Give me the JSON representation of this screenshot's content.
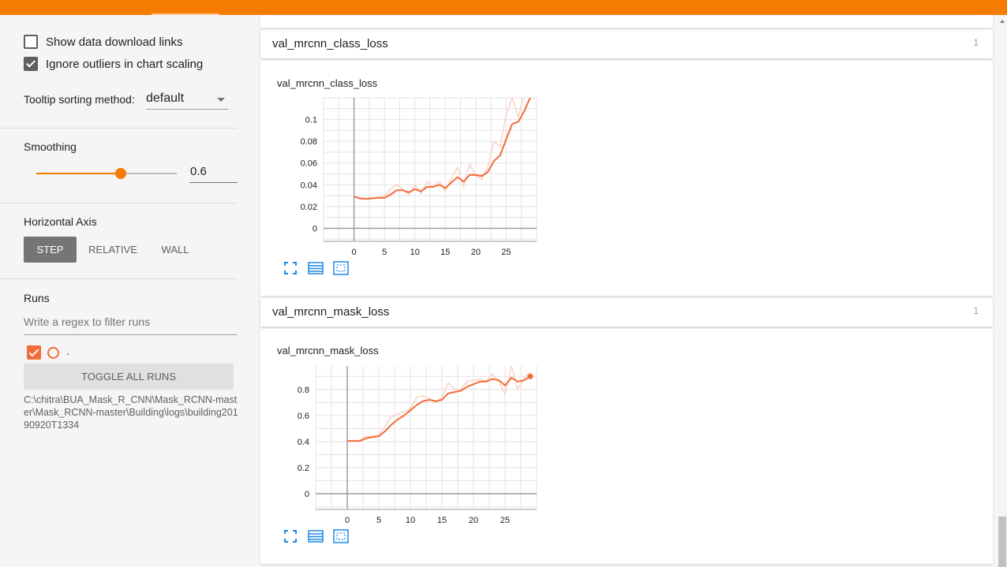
{
  "sidebar": {
    "show_download_links": {
      "label": "Show data download links",
      "checked": false
    },
    "ignore_outliers": {
      "label": "Ignore outliers in chart scaling",
      "checked": true
    },
    "tooltip_sorting": {
      "label": "Tooltip sorting method:",
      "value": "default"
    },
    "smoothing": {
      "label": "Smoothing",
      "value": "0.6",
      "fraction": 0.6
    },
    "horizontal_axis": {
      "label": "Horizontal Axis",
      "options": [
        "STEP",
        "RELATIVE",
        "WALL"
      ],
      "selected": "STEP"
    },
    "runs": {
      "label": "Runs",
      "filter_placeholder": "Write a regex to filter runs",
      "run_name": ".",
      "toggle_label": "TOGGLE ALL RUNS",
      "path": "C:\\chitra\\BUA_Mask_R_CNN\\Mask_RCNN-master\\Mask_RCNN-master\\Building\\logs\\building20190920T1334"
    }
  },
  "colors": {
    "accent": "#f57c00",
    "series": "#f26b3a",
    "series_raw": "#fbd3c4"
  },
  "cards": [
    {
      "header": "val_mrcnn_class_loss",
      "count": "1",
      "chart_title": "val_mrcnn_class_loss"
    },
    {
      "header": "val_mrcnn_mask_loss",
      "count": "1",
      "chart_title": "val_mrcnn_mask_loss"
    }
  ],
  "chart_data": [
    {
      "type": "line",
      "title": "val_mrcnn_class_loss",
      "x_ticks": [
        "0",
        "5",
        "10",
        "15",
        "20",
        "25"
      ],
      "y_ticks": [
        "0",
        "0.02",
        "0.04",
        "0.06",
        "0.08",
        "0.1"
      ],
      "xlim": [
        -5,
        30
      ],
      "ylim": [
        -0.012,
        0.12
      ],
      "grid": true,
      "series": [
        {
          "role": "smoothed",
          "x": [
            0,
            1,
            2,
            3,
            4,
            5,
            6,
            7,
            8,
            9,
            10,
            11,
            12,
            13,
            14,
            15,
            16,
            17,
            18,
            19,
            20,
            21,
            22,
            23,
            24,
            25,
            26,
            27,
            28,
            29
          ],
          "y": [
            0.029,
            0.0275,
            0.027,
            0.0275,
            0.028,
            0.028,
            0.031,
            0.035,
            0.035,
            0.033,
            0.036,
            0.034,
            0.038,
            0.038,
            0.04,
            0.037,
            0.042,
            0.047,
            0.043,
            0.049,
            0.049,
            0.048,
            0.052,
            0.062,
            0.067,
            0.082,
            0.096,
            0.098,
            0.108,
            0.121
          ]
        },
        {
          "role": "raw",
          "x": [
            0,
            1,
            2,
            3,
            4,
            5,
            6,
            7,
            8,
            9,
            10,
            11,
            12,
            13,
            14,
            15,
            16,
            17,
            18,
            19,
            20,
            21,
            22,
            23,
            24,
            25,
            26,
            27,
            28,
            29
          ],
          "y": [
            0.03,
            0.027,
            0.027,
            0.028,
            0.028,
            0.03,
            0.036,
            0.04,
            0.036,
            0.031,
            0.04,
            0.032,
            0.043,
            0.039,
            0.043,
            0.034,
            0.046,
            0.056,
            0.038,
            0.059,
            0.048,
            0.045,
            0.057,
            0.08,
            0.075,
            0.105,
            0.12,
            0.102,
            0.125,
            0.13
          ]
        }
      ]
    },
    {
      "type": "line",
      "title": "val_mrcnn_mask_loss",
      "x_ticks": [
        "0",
        "5",
        "10",
        "15",
        "20",
        "25"
      ],
      "y_ticks": [
        "0",
        "0.2",
        "0.4",
        "0.6",
        "0.8"
      ],
      "xlim": [
        -5,
        30
      ],
      "ylim": [
        -0.12,
        0.98
      ],
      "grid": true,
      "series": [
        {
          "role": "smoothed",
          "x": [
            0,
            1,
            2,
            3,
            4,
            5,
            6,
            7,
            8,
            9,
            10,
            11,
            12,
            13,
            14,
            15,
            16,
            17,
            18,
            19,
            20,
            21,
            22,
            23,
            24,
            25,
            26,
            27,
            28,
            29
          ],
          "y": [
            0.405,
            0.405,
            0.405,
            0.425,
            0.435,
            0.44,
            0.48,
            0.53,
            0.57,
            0.6,
            0.64,
            0.68,
            0.71,
            0.72,
            0.71,
            0.72,
            0.77,
            0.78,
            0.79,
            0.82,
            0.84,
            0.86,
            0.86,
            0.88,
            0.87,
            0.83,
            0.89,
            0.86,
            0.87,
            0.9
          ]
        },
        {
          "role": "raw",
          "x": [
            0,
            1,
            2,
            3,
            4,
            5,
            6,
            7,
            8,
            9,
            10,
            11,
            12,
            13,
            14,
            15,
            16,
            17,
            18,
            19,
            20,
            21,
            22,
            23,
            24,
            25,
            26,
            27,
            28,
            29
          ],
          "y": [
            0.405,
            0.405,
            0.41,
            0.44,
            0.44,
            0.45,
            0.52,
            0.59,
            0.61,
            0.63,
            0.65,
            0.74,
            0.75,
            0.73,
            0.7,
            0.74,
            0.85,
            0.8,
            0.8,
            0.86,
            0.87,
            0.88,
            0.86,
            0.92,
            0.86,
            0.76,
            0.98,
            0.8,
            0.89,
            0.93
          ]
        }
      ]
    }
  ]
}
